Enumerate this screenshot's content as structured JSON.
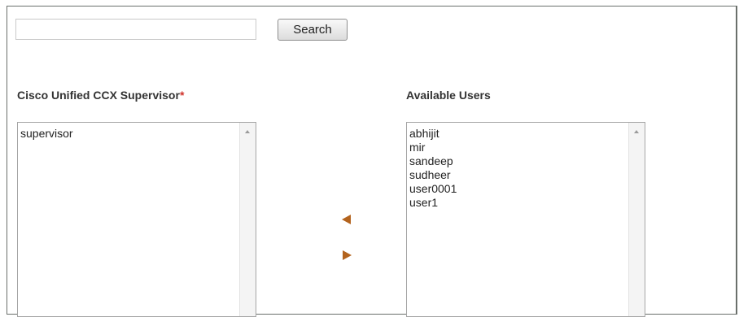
{
  "search": {
    "value": "",
    "placeholder": "",
    "button_label": "Search"
  },
  "supervisor_list": {
    "label": "Cisco Unified CCX Supervisor",
    "required_marker": "*",
    "items": [
      "supervisor"
    ]
  },
  "available_users": {
    "label": "Available Users",
    "items": [
      "abhijit",
      "mir",
      "sandeep",
      "sudheer",
      "user0001",
      "user1"
    ]
  },
  "controls": {
    "move_left_icon": "arrow-left-icon",
    "move_right_icon": "arrow-right-icon"
  },
  "colors": {
    "arrow": "#b3631d",
    "required": "#d0342c"
  }
}
